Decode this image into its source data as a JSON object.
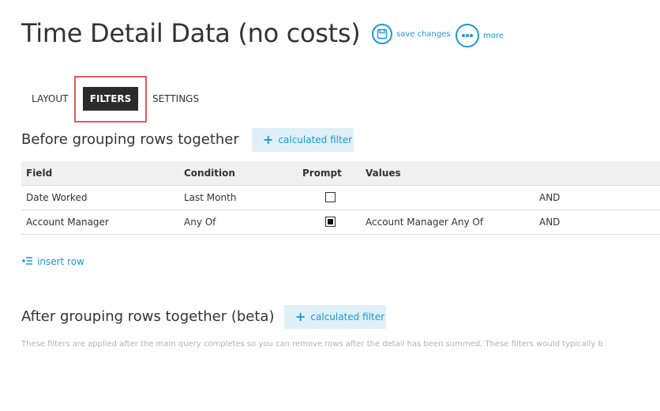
{
  "header": {
    "title": "Time Detail Data (no costs)",
    "save_label": "save changes",
    "more_label": "more"
  },
  "tabs": [
    {
      "label": "LAYOUT",
      "active": false
    },
    {
      "label": "FILTERS",
      "active": true
    },
    {
      "label": "SETTINGS",
      "active": false
    }
  ],
  "before_section": {
    "title": "Before grouping rows together",
    "calc_button_label": "calculated filter"
  },
  "table": {
    "headers": [
      "Field",
      "Condition",
      "Prompt",
      "Values"
    ],
    "rows": [
      {
        "field": "Date Worked",
        "condition": "Last Month",
        "prompt_checked": false,
        "values": "",
        "connector": "AND"
      },
      {
        "field": "Account Manager",
        "condition": "Any Of",
        "prompt_checked": true,
        "values": "Account Manager Any Of",
        "connector": "AND"
      }
    ]
  },
  "insert_row_label": "insert row",
  "after_section": {
    "title": "After grouping rows together (beta)",
    "calc_button_label": "calculated filter",
    "note": "These filters are applied after the main query completes so you can remove rows after the detail has been summed. These filters would typically b"
  },
  "colors": {
    "accent": "#1a9ad6",
    "tab_active_bg": "#2b2b2b",
    "highlight": "#e05a5a",
    "button_bg": "#dff0f9"
  }
}
